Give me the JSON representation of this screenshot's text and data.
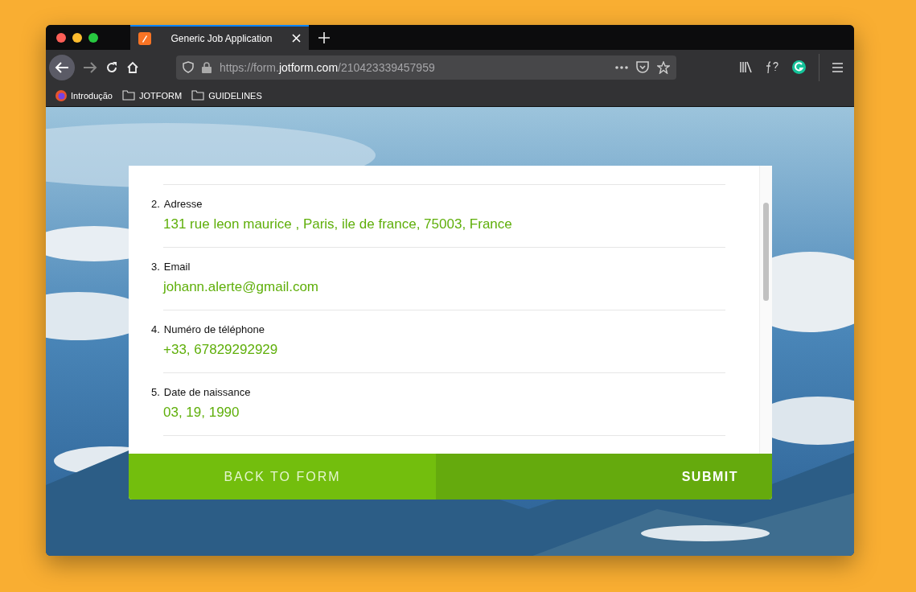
{
  "tab": {
    "title": "Generic Job Application",
    "selected": true
  },
  "url": {
    "prefix": "https://form.",
    "domain": "jotform.com",
    "path": "/210423339457959"
  },
  "bookmarks": [
    {
      "kind": "site",
      "label": "Introdução"
    },
    {
      "kind": "folder",
      "label": "JOTFORM"
    },
    {
      "kind": "folder",
      "label": "GUIDELINES"
    }
  ],
  "answers": [
    {
      "number": "2.",
      "question": "Adresse",
      "value": "131 rue leon maurice , Paris, ile de france, 75003, France"
    },
    {
      "number": "3.",
      "question": "Email",
      "value": "johann.alerte@gmail.com"
    },
    {
      "number": "4.",
      "question": "Numéro de téléphone",
      "value": "+33, 67829292929"
    },
    {
      "number": "5.",
      "question": "Date de naissance",
      "value": "03, 19, 1990"
    }
  ],
  "buttons": {
    "back": "BACK TO FORM",
    "submit": "SUBMIT"
  }
}
